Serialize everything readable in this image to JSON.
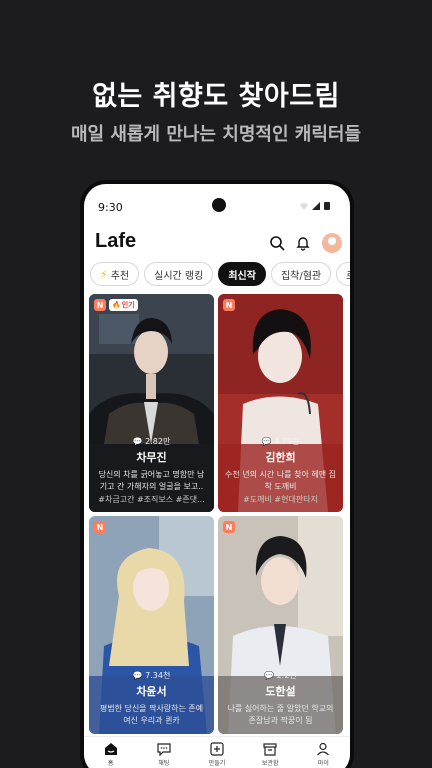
{
  "promo": {
    "title": "없는 취향도 찾아드림",
    "subtitle": "매일 새롭게 만나는 치명적인 캐릭터들"
  },
  "status_bar": {
    "time": "9:30",
    "icons": "wifi-icon signal-icon battery-icon"
  },
  "header": {
    "logo": "Lafe",
    "icons": [
      "search-icon",
      "bell-icon",
      "profile-avatar"
    ],
    "accent_color": "#f3b79e"
  },
  "tabs": [
    {
      "label": "추천",
      "icon": "bolt-icon"
    },
    {
      "label": "실시간 랭킹"
    },
    {
      "label": "최신작",
      "active": true
    },
    {
      "label": "집착/혐관"
    },
    {
      "label": "로판"
    }
  ],
  "cards": [
    {
      "badge": "N",
      "hot_label": "인기",
      "count": "2.82만",
      "name": "차무진",
      "desc": "당신의 차를 긁어놓고 명함만 남기고 간 가해자의 얼굴을 보고..",
      "tags": "#차금고간 #조직보스 #존댓..."
    },
    {
      "badge": "N",
      "count": "4.79만",
      "name": "김한희",
      "desc": "수천 년의 시간 나를 찾아 헤맨 집착 도깨비",
      "tags": "#도깨비 #현대판타지"
    },
    {
      "badge": "N",
      "count": "7.34천",
      "name": "차윤서",
      "desc": "평범한 당신을 짝사랑하는 존예 여신 우리과 퀸카",
      "tags": ""
    },
    {
      "badge": "N",
      "count": "2.2천",
      "name": "도한설",
      "desc": "나를 싫어하는 줄 알았던 학교의 존잘남과 짝꿍이 됨",
      "tags": ""
    }
  ],
  "bottom_nav": [
    {
      "label": "홈",
      "icon": "home-icon"
    },
    {
      "label": "채팅",
      "icon": "chat-icon"
    },
    {
      "label": "만들기",
      "icon": "plus-square-icon"
    },
    {
      "label": "보관함",
      "icon": "archive-icon"
    },
    {
      "label": "마이",
      "icon": "user-icon"
    }
  ]
}
